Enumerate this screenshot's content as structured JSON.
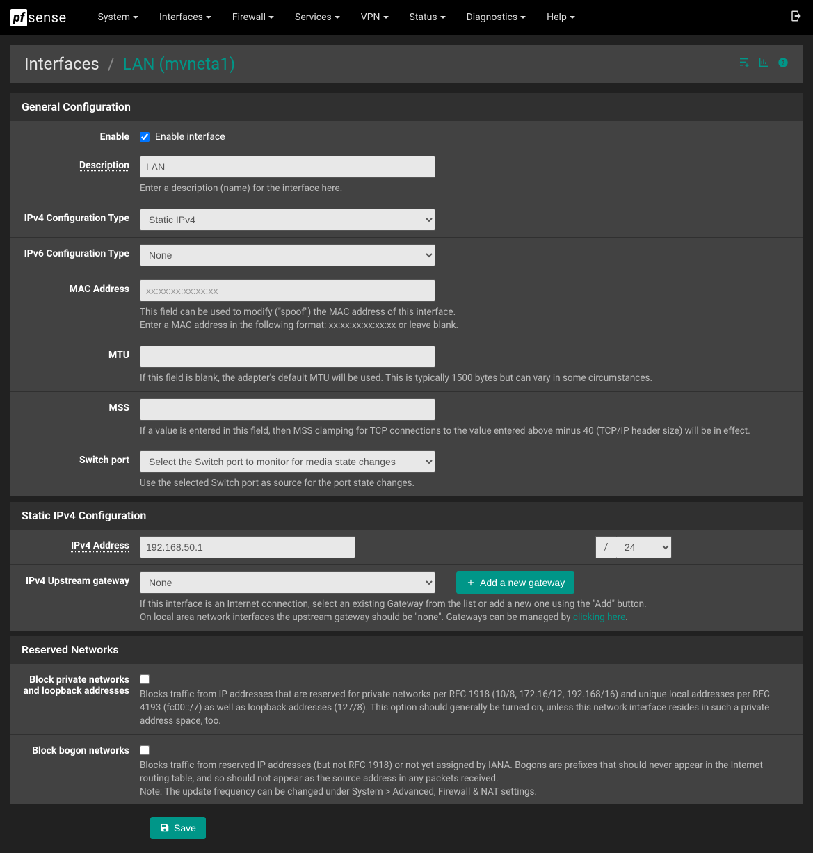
{
  "nav": {
    "items": [
      "System",
      "Interfaces",
      "Firewall",
      "Services",
      "VPN",
      "Status",
      "Diagnostics",
      "Help"
    ]
  },
  "breadcrumb": {
    "root": "Interfaces",
    "current": "LAN (mvneta1)"
  },
  "panels": {
    "general": {
      "title": "General Configuration",
      "enable": {
        "label": "Enable",
        "checkbox_label": "Enable interface",
        "checked": true
      },
      "description": {
        "label": "Description",
        "value": "LAN",
        "help": "Enter a description (name) for the interface here."
      },
      "ipv4type": {
        "label": "IPv4 Configuration Type",
        "value": "Static IPv4"
      },
      "ipv6type": {
        "label": "IPv6 Configuration Type",
        "value": "None"
      },
      "mac": {
        "label": "MAC Address",
        "placeholder": "xx:xx:xx:xx:xx:xx",
        "help": "This field can be used to modify (\"spoof\") the MAC address of this interface.\nEnter a MAC address in the following format: xx:xx:xx:xx:xx:xx or leave blank."
      },
      "mtu": {
        "label": "MTU",
        "help": "If this field is blank, the adapter's default MTU will be used. This is typically 1500 bytes but can vary in some circumstances."
      },
      "mss": {
        "label": "MSS",
        "help": "If a value is entered in this field, then MSS clamping for TCP connections to the value entered above minus 40 (TCP/IP header size) will be in effect."
      },
      "switchport": {
        "label": "Switch port",
        "value": "Select the Switch port to monitor for media state changes",
        "help": "Use the selected Switch port as source for the port state changes."
      }
    },
    "staticipv4": {
      "title": "Static IPv4 Configuration",
      "addr": {
        "label": "IPv4 Address",
        "value": "192.168.50.1",
        "cidr": "24"
      },
      "gw": {
        "label": "IPv4 Upstream gateway",
        "value": "None",
        "add_button": "Add a new gateway",
        "help_pre": "If this interface is an Internet connection, select an existing Gateway from the list or add a new one using the \"Add\" button.\nOn local area network interfaces the upstream gateway should be \"none\". Gateways can be managed by ",
        "link": "clicking here",
        "help_post": "."
      }
    },
    "reserved": {
      "title": "Reserved Networks",
      "private": {
        "label": "Block private networks and loopback addresses",
        "help": "Blocks traffic from IP addresses that are reserved for private networks per RFC 1918 (10/8, 172.16/12, 192.168/16) and unique local addresses per RFC 4193 (fc00::/7) as well as loopback addresses (127/8). This option should generally be turned on, unless this network interface resides in such a private address space, too."
      },
      "bogon": {
        "label": "Block bogon networks",
        "help": "Blocks traffic from reserved IP addresses (but not RFC 1918) or not yet assigned by IANA. Bogons are prefixes that should never appear in the Internet routing table, and so should not appear as the source address in any packets received.\nNote: The update frequency can be changed under System > Advanced, Firewall & NAT settings."
      }
    }
  },
  "save_button": "Save"
}
